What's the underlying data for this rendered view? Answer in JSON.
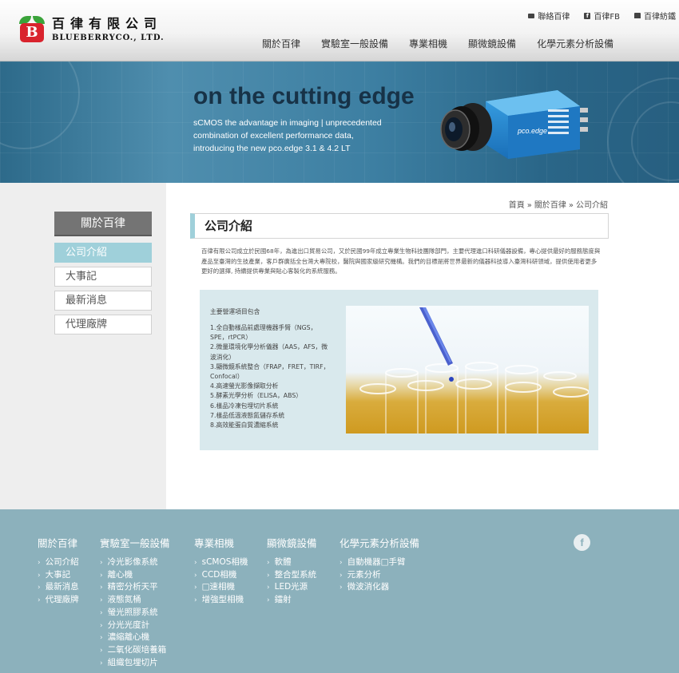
{
  "brand": {
    "name_cn": "百律有限公司",
    "name_en": "BLUEBERRYCO., LTD.",
    "mark": "B"
  },
  "top_links": [
    {
      "icon": "mail-icon",
      "label": "聯絡百律"
    },
    {
      "icon": "facebook-icon",
      "label": "百律FB"
    },
    {
      "icon": "shop-icon",
      "label": "百律紡鐵"
    }
  ],
  "nav": [
    "關於百律",
    "實驗室一般設備",
    "專業相機",
    "顯微鏡設備",
    "化學元素分析設備"
  ],
  "banner": {
    "title": "on the cutting edge",
    "lines": [
      "sCMOS the advantage in imaging | unprecedented",
      "combination of excellent performance data,",
      "introducing the new pco.edge 3.1 & 4.2 LT"
    ],
    "camera_brand": "pco.edge"
  },
  "sidebar": {
    "title": "關於百律",
    "items": [
      "公司介紹",
      "大事記",
      "最新消息",
      "代理廠牌"
    ],
    "active_index": 0
  },
  "breadcrumb": [
    "首頁",
    "關於百律",
    "公司介紹"
  ],
  "page_title": "公司介紹",
  "intro": "百律有限公司成立於民國68年，為進出口貿易公司，又於民國99年成立專業生物科技團隊部門，主要代理進口科研儀器設備，專心提供最好的服務態度與產品至臺灣的生技產業，客戶群廣括全台灣大專院校，醫院與國家級研究機構。我們的目標是將世界最新的儀器科技導入臺灣科研領域，提供使用者更多更好的選擇, 持續提供專業與貼心客製化的系統服務。",
  "panel": {
    "heading": "主要營運項目包含",
    "items": [
      "1.全自動樣品前處理機器手臂（NGS，SPE，rtPCR）",
      "2.微量環境化學分析儀器（AAS，AFS，微波消化）",
      "3.顯微鏡系統整合（FRAP，FRET，TIRF，Confocal）",
      "4.高速螢光影像擷取分析",
      "5.酵素光學分析（ELISA，ABS）",
      "6.樣品冷凍包埋切片系統",
      "7.樣品低溫液態氮儲存系統",
      "8.高效能蛋白質濃縮系統"
    ]
  },
  "footer": {
    "columns": [
      {
        "title": "關於百律",
        "items": [
          "公司介紹",
          "大事記",
          "最新消息",
          "代理廠牌"
        ]
      },
      {
        "title": "實驗室一般設備",
        "items": [
          "冷光影像系統",
          "離心機",
          "精密分析天平",
          "液態氮桶",
          "螢光照膠系統",
          "分光光度計",
          "濃縮離心機",
          "二氧化碳培養箱",
          "組織包埋切片"
        ]
      },
      {
        "title": "專業相機",
        "items": [
          "sCMOS相機",
          "CCD相機",
          "□速相機",
          "增強型相機"
        ]
      },
      {
        "title": "顯微鏡設備",
        "items": [
          "軟體",
          "整合型系統",
          "LED光源",
          "鐳射"
        ]
      },
      {
        "title": "化學元素分析設備",
        "items": [
          "自動機器□手臂",
          "元素分析",
          "微波消化器"
        ]
      }
    ],
    "social_icon": "facebook-icon",
    "social_glyph": "f"
  },
  "colors": {
    "accent": "#9fd0da",
    "footer": "#8cb1bc",
    "sidebar_head": "#747474",
    "brand_red": "#d9232d"
  }
}
